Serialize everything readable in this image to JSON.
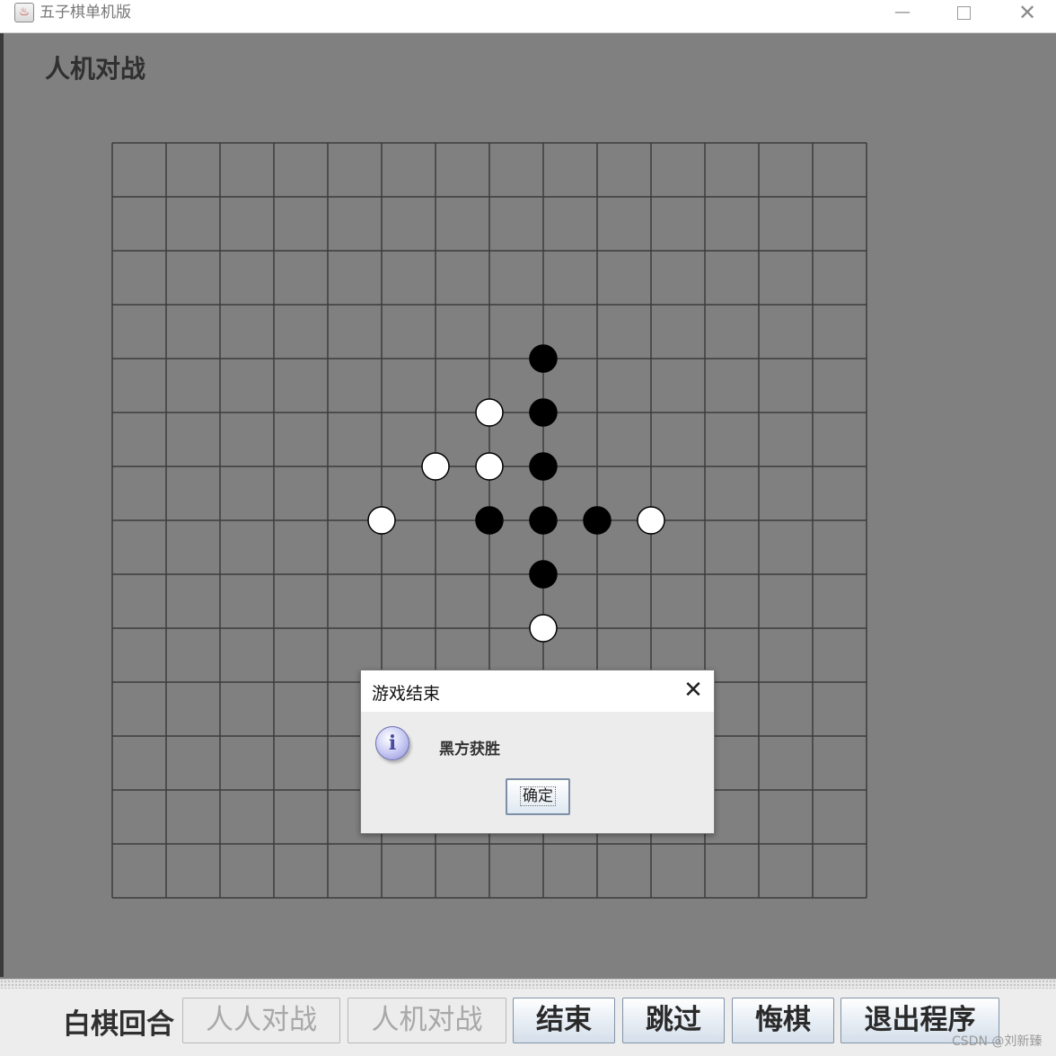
{
  "window": {
    "title": "五子棋单机版",
    "controls": {
      "minimize": "—",
      "maximize": "□",
      "close": "✕"
    }
  },
  "mode_title": "人机对战",
  "board": {
    "rows": 14,
    "cols": 14,
    "grid_color": "#3c3c3c",
    "board_color": "#808080",
    "stones": [
      {
        "col": 8,
        "row": 4,
        "color": "black"
      },
      {
        "col": 7,
        "row": 5,
        "color": "white"
      },
      {
        "col": 8,
        "row": 5,
        "color": "black"
      },
      {
        "col": 6,
        "row": 6,
        "color": "white"
      },
      {
        "col": 7,
        "row": 6,
        "color": "white"
      },
      {
        "col": 8,
        "row": 6,
        "color": "black"
      },
      {
        "col": 5,
        "row": 7,
        "color": "white"
      },
      {
        "col": 7,
        "row": 7,
        "color": "black"
      },
      {
        "col": 8,
        "row": 7,
        "color": "black"
      },
      {
        "col": 9,
        "row": 7,
        "color": "black"
      },
      {
        "col": 10,
        "row": 7,
        "color": "white"
      },
      {
        "col": 8,
        "row": 8,
        "color": "black"
      },
      {
        "col": 8,
        "row": 9,
        "color": "white"
      }
    ]
  },
  "dialog": {
    "title": "游戏结束",
    "close_glyph": "✕",
    "icon": "info-icon",
    "icon_glyph": "i",
    "message": "黑方获胜",
    "ok_label": "确定"
  },
  "bottom": {
    "turn_label": "白棋回合",
    "buttons": [
      {
        "label": "人人对战",
        "enabled": false
      },
      {
        "label": "人机对战",
        "enabled": false
      },
      {
        "label": "结束",
        "enabled": true
      },
      {
        "label": "跳过",
        "enabled": true
      },
      {
        "label": "悔棋",
        "enabled": true
      },
      {
        "label": "退出程序",
        "enabled": true
      }
    ]
  },
  "watermark": "CSDN @刘新臻"
}
